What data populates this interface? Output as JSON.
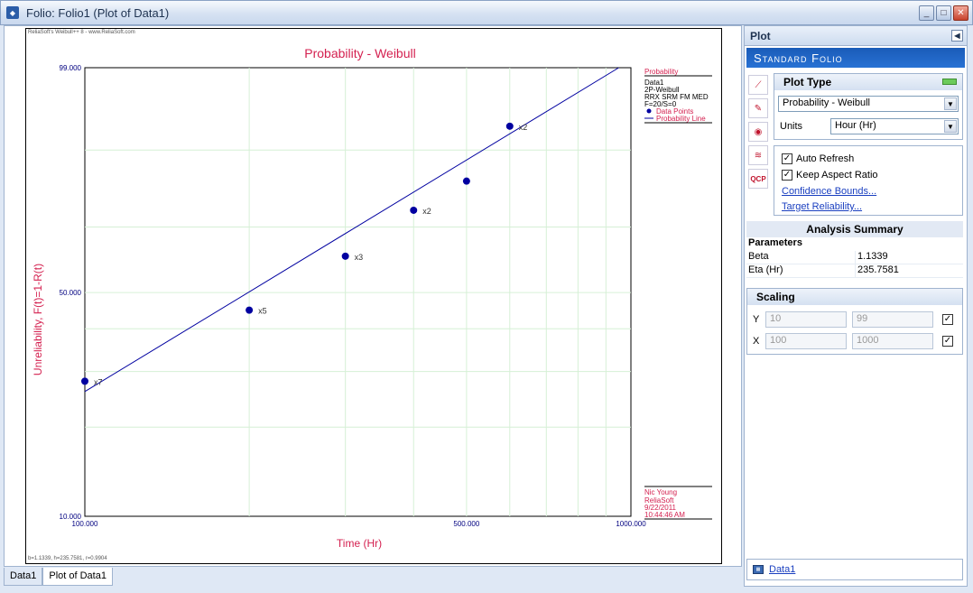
{
  "window": {
    "title": "Folio: Folio1 (Plot of Data1)"
  },
  "plot": {
    "watermark": "ReliaSoft's Weibull++ 8 - www.ReliaSoft.com",
    "footer_stats": "b=1.1339, h=235.7581, r=0.9904",
    "legend": {
      "heading": "Probability",
      "lines": [
        "Data1",
        "2P-Weibull",
        "RRX SRM FM MED",
        "F=20/S=0"
      ],
      "data_points_label": "Data Points",
      "probability_line_label": "Probability Line"
    },
    "author": {
      "name": "Nic Young",
      "company": "ReliaSoft",
      "date": "9/22/2011",
      "time": "10:44:46 AM"
    }
  },
  "chart_data": {
    "type": "scatter",
    "title": "Probability - Weibull",
    "xlabel": "Time (Hr)",
    "ylabel": "Unreliability, F(t)=1-R(t)",
    "x_scale": "log",
    "y_scale": "weibull",
    "xlim": [
      100,
      1000
    ],
    "ylim": [
      10,
      99
    ],
    "x_ticks": [
      "100.000",
      "500.000",
      "1000.000"
    ],
    "y_ticks": [
      "10.000",
      "50.000",
      "99.000"
    ],
    "grid": true,
    "legend_position": "right",
    "series": [
      {
        "name": "Data Points",
        "points": [
          {
            "x": 100,
            "y": 28,
            "label": "x7"
          },
          {
            "x": 200,
            "y": 45,
            "label": "x5"
          },
          {
            "x": 300,
            "y": 61,
            "label": "x3"
          },
          {
            "x": 400,
            "y": 75,
            "label": "x2"
          },
          {
            "x": 500,
            "y": 83,
            "label": ""
          },
          {
            "x": 600,
            "y": 94,
            "label": "x2"
          }
        ]
      },
      {
        "name": "Probability Line",
        "points": [
          {
            "x": 100,
            "y": 26
          },
          {
            "x": 950,
            "y": 99
          }
        ]
      }
    ],
    "colors": {
      "points": "#0000a0",
      "line": "#0000a0",
      "title": "#d42150",
      "axis": "#000080"
    }
  },
  "tabs": [
    "Data1",
    "Plot of Data1"
  ],
  "panel": {
    "header": "Plot",
    "banner": "Standard Folio",
    "tools": [
      "plot-line-icon",
      "plot-edit-icon",
      "rs-draw-icon",
      "multi-plot-icon",
      "qcp-icon"
    ],
    "plot_type_heading": "Plot Type",
    "plot_type_value": "Probability - Weibull",
    "units_label": "Units",
    "units_value": "Hour (Hr)",
    "auto_refresh_label": "Auto Refresh",
    "keep_aspect_label": "Keep Aspect Ratio",
    "confidence_link": "Confidence Bounds...",
    "target_link": "Target Reliability...",
    "summary_title": "Analysis Summary",
    "parameters_label": "Parameters",
    "params": [
      {
        "k": "Beta",
        "v": "1.1339"
      },
      {
        "k": "Eta (Hr)",
        "v": "235.7581"
      }
    ],
    "scaling_title": "Scaling",
    "y_label": "Y",
    "y_min": "10",
    "y_max": "99",
    "x_label": "X",
    "x_min": "100",
    "x_max": "1000",
    "bottom_item": "Data1"
  }
}
